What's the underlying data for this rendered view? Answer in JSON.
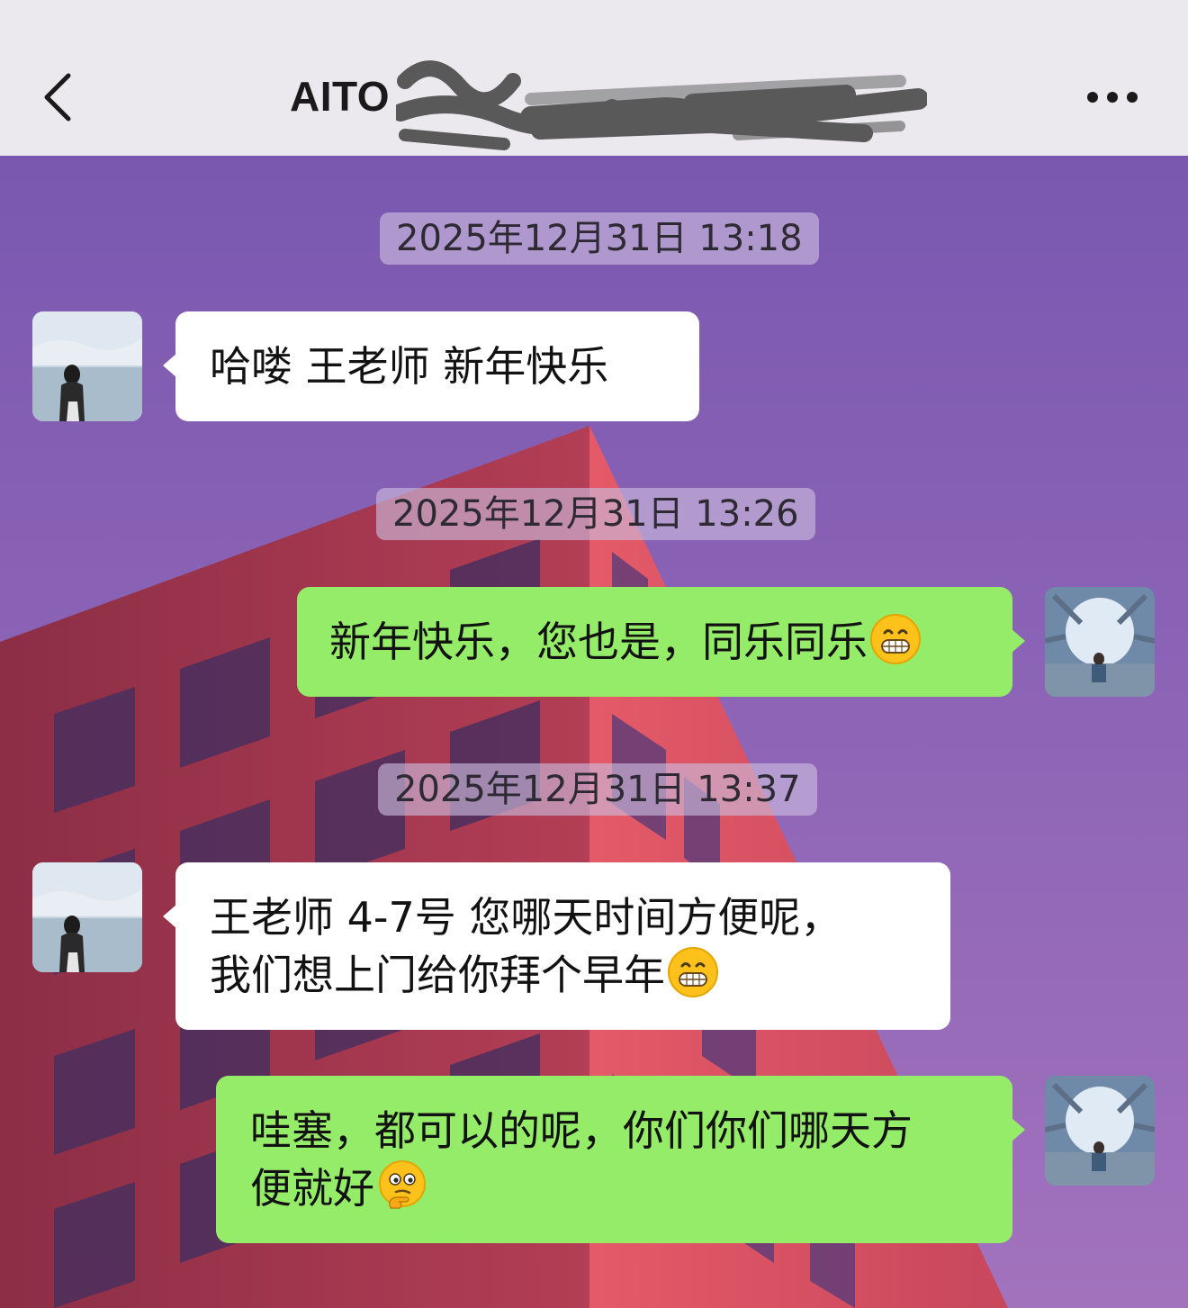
{
  "header": {
    "title": "AITO",
    "back_icon": "chevron-left-icon",
    "more_icon": "more-horizontal-icon"
  },
  "colors": {
    "header_bg": "#ece9ee",
    "incoming_bubble": "#ffffff",
    "outgoing_bubble": "#95ec69",
    "wallpaper_sky": "#8b62b4",
    "wallpaper_building": "#c1475a"
  },
  "messages": [
    {
      "type": "timestamp",
      "text": "2025年12月31日 13:18"
    },
    {
      "type": "incoming",
      "lines": [
        "哈喽  王老师  新年快乐"
      ]
    },
    {
      "type": "timestamp",
      "text": "2025年12月31日 13:26"
    },
    {
      "type": "outgoing",
      "lines": [
        "新年快乐，您也是，同乐同乐"
      ],
      "emoji": "grinning-face-emoji"
    },
    {
      "type": "timestamp",
      "text": "2025年12月31日 13:37"
    },
    {
      "type": "incoming",
      "lines": [
        "王老师   4-7号  您哪天时间方便呢，",
        "我们想上门给你拜个早年"
      ],
      "emoji": "grinning-face-emoji"
    },
    {
      "type": "outgoing",
      "lines": [
        "哇塞，都可以的呢，你们你们哪天方",
        "便就好"
      ],
      "emoji": "thinking-face-emoji"
    }
  ]
}
